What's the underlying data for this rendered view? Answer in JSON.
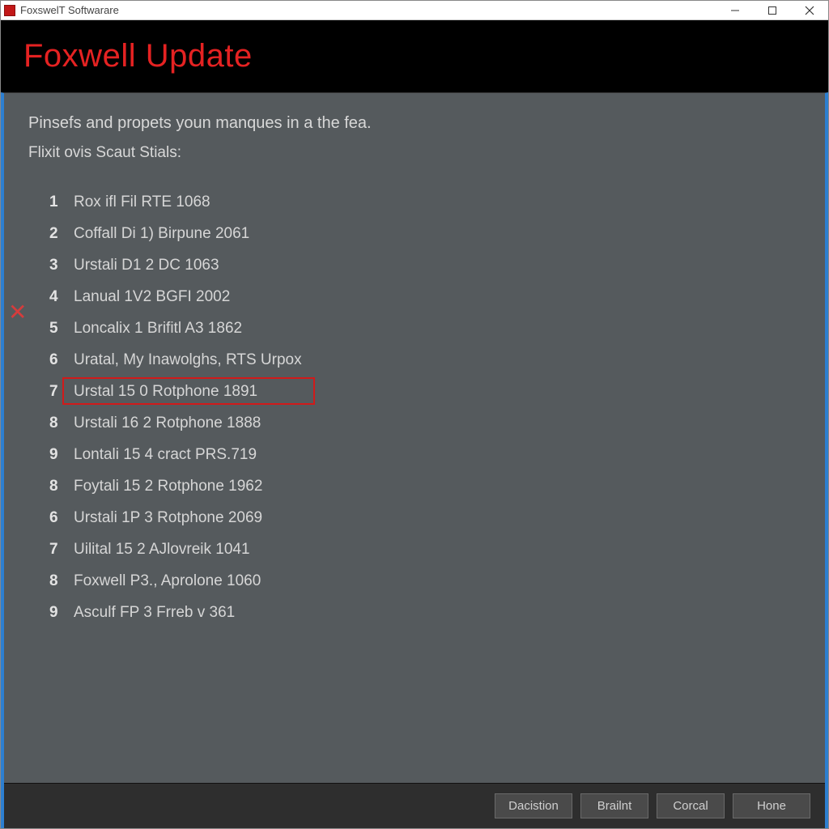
{
  "titlebar": {
    "title": "FoxswelT Softwarare"
  },
  "header": {
    "title": "Foxwell Update"
  },
  "intro": {
    "line1": "Pinsefs and propets youn manques in a the fea.",
    "line2": "Flixit ovis Scaut Stials:"
  },
  "items": [
    {
      "num": "1",
      "label": "Rox ifl Fil RTE 1068",
      "hl": false
    },
    {
      "num": "2",
      "label": "Coffall Di 1) Birpune 2061",
      "hl": false
    },
    {
      "num": "3",
      "label": "Urstali D1 2 DC 1063",
      "hl": false
    },
    {
      "num": "4",
      "label": "Lanual 1V2 BGFI 2002",
      "hl": false
    },
    {
      "num": "5",
      "label": "Loncalix 1 Brifitl A3 1862",
      "hl": false
    },
    {
      "num": "6",
      "label": "Uratal, My Inawolghs, RTS Urpox",
      "hl": false
    },
    {
      "num": "7",
      "label": "Urstal 15 0 Rotphone 1891",
      "hl": true,
      "hlWidth": 312
    },
    {
      "num": "8",
      "label": "Urstali 16 2 Rotphone 1888",
      "hl": false
    },
    {
      "num": "9",
      "label": "Lontali 15 4 cract PRS.719",
      "hl": false
    },
    {
      "num": "8",
      "label": "Foytali 15 2 Rotphone 1962",
      "hl": false
    },
    {
      "num": "6",
      "label": "Urstali 1P 3 Rotphone 2069",
      "hl": false
    },
    {
      "num": "7",
      "label": "Uilital 15 2 AJlovreik 1041",
      "hl": false
    },
    {
      "num": "8",
      "label": "Foxwell P3., Aprolone 1060",
      "hl": false
    },
    {
      "num": "9",
      "label": "Asculf FP 3 Frreb v 361",
      "hl": false
    }
  ],
  "xMarker": "✕",
  "footer": {
    "buttons": [
      {
        "label": "Dacistion"
      },
      {
        "label": "Brailnt"
      },
      {
        "label": "Corcal"
      },
      {
        "label": "Hone"
      }
    ]
  }
}
